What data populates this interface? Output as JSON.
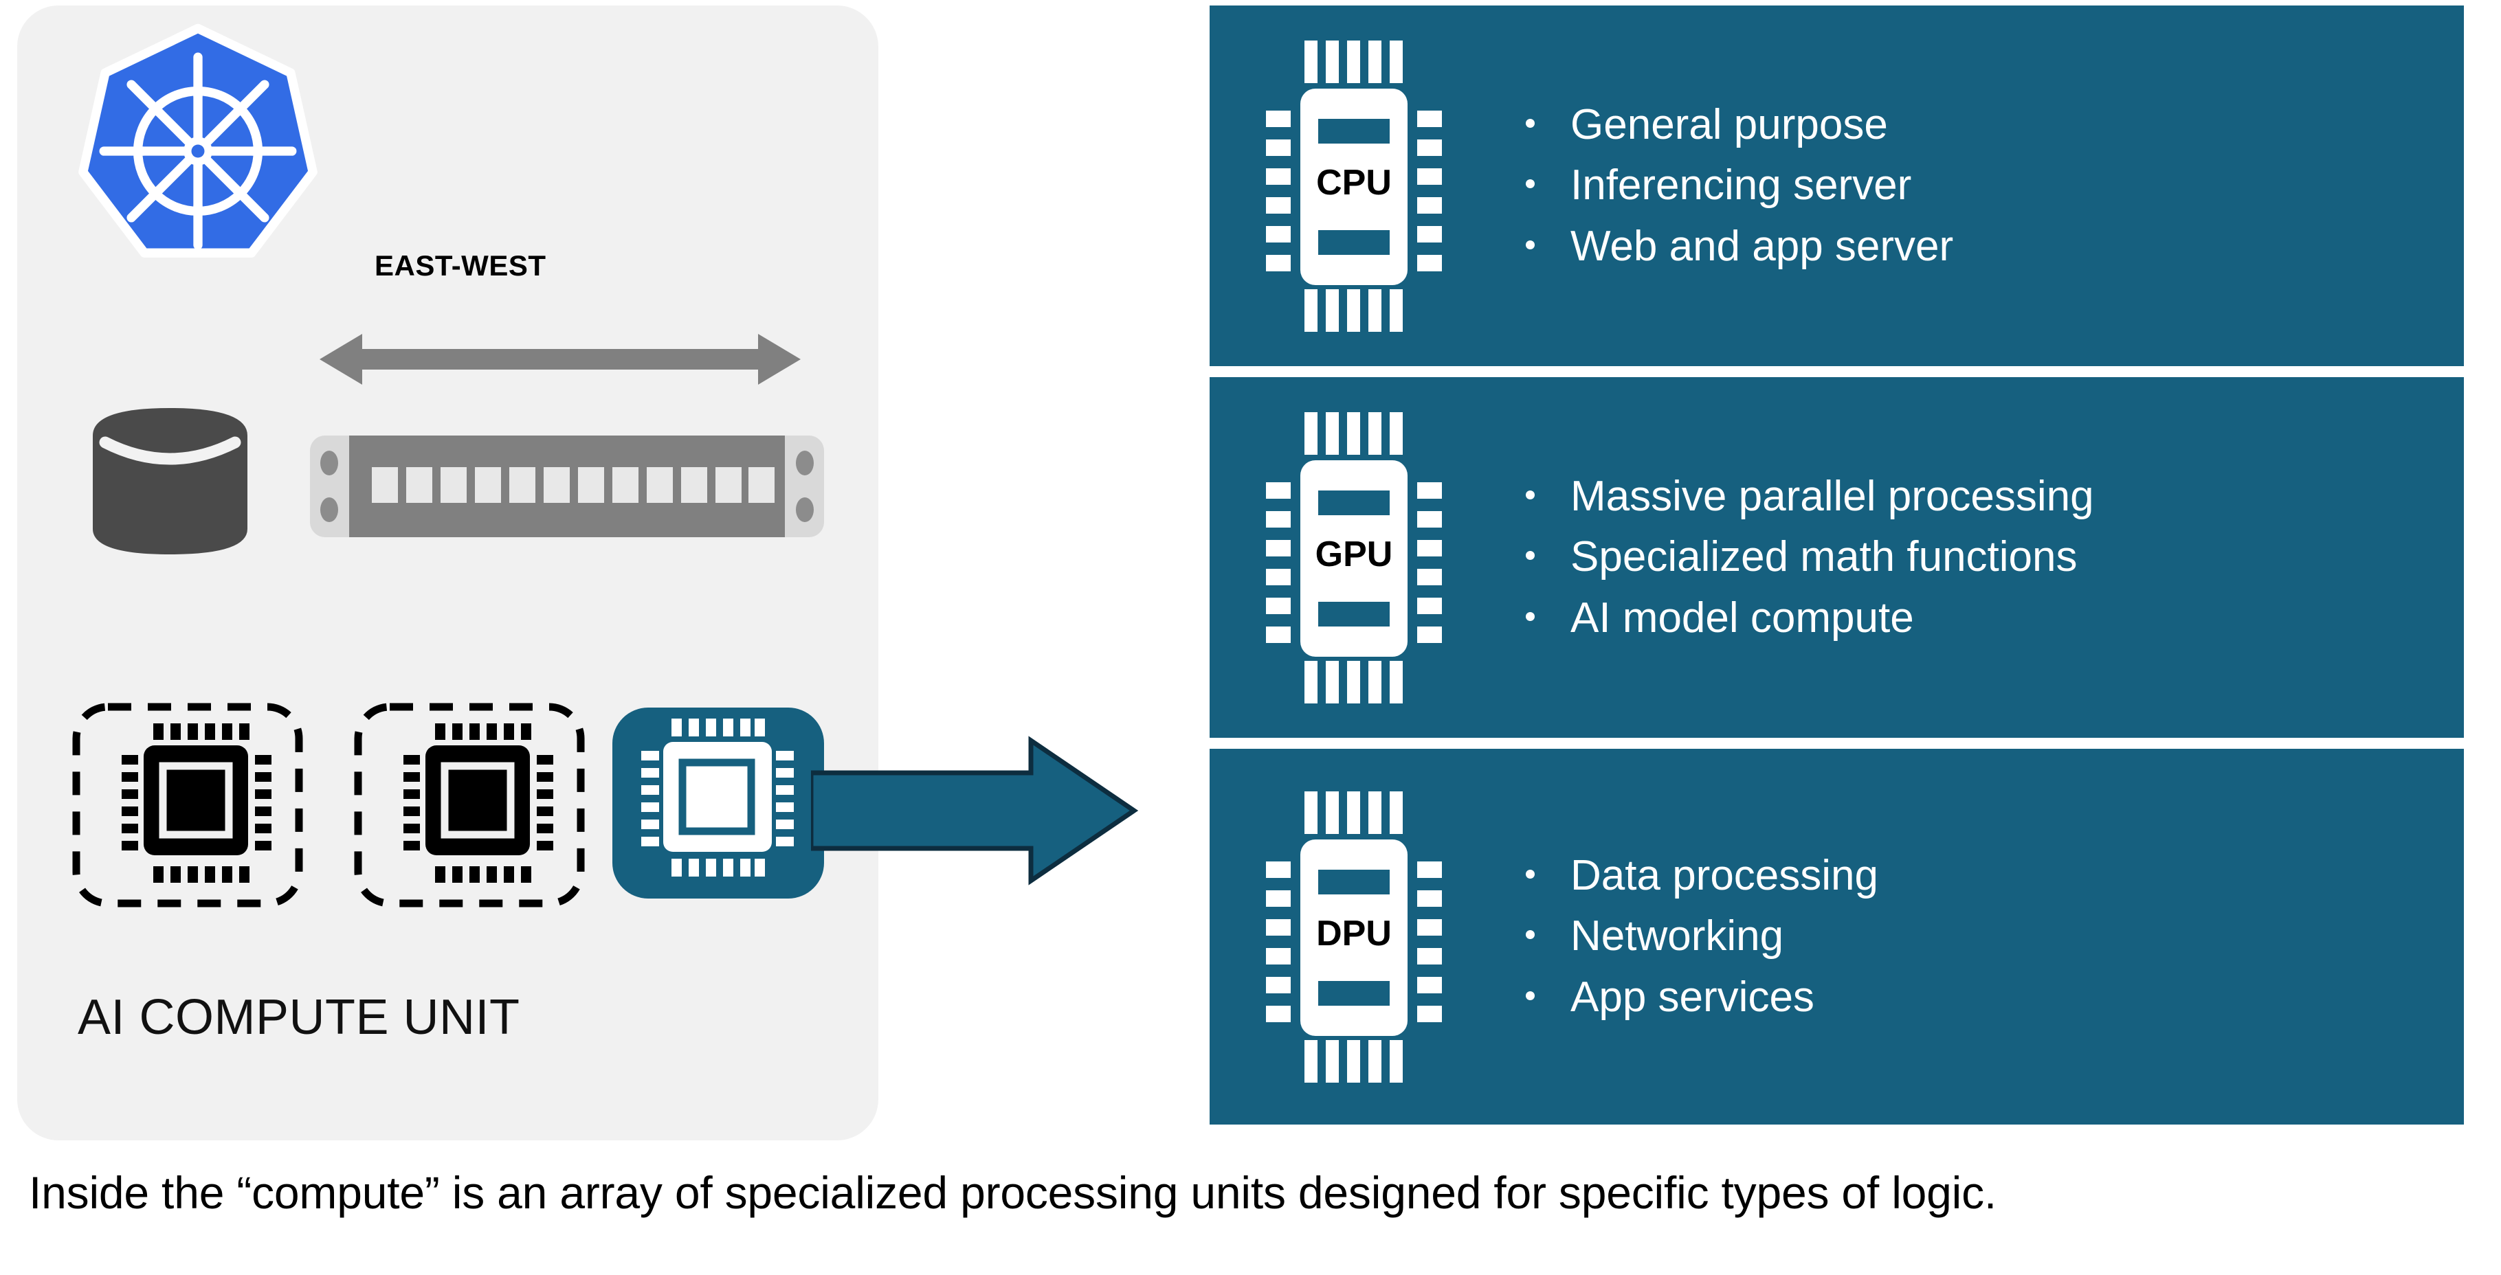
{
  "colors": {
    "panel_bg": "#f1f1f1",
    "teal": "#16607f",
    "arrow_outline": "#0d2d3f",
    "kubernetes_blue": "#326ce5",
    "switch_gray": "#808080",
    "switch_rail": "#d9d9d9",
    "db_gray": "#4a4a4a",
    "ew_arrow_gray": "#808080",
    "chip_black": "#000000",
    "white": "#ffffff"
  },
  "left_panel": {
    "logo_name": "kubernetes-icon",
    "east_west_label": "EAST-WEST",
    "east_west_arrow_name": "east-west-double-arrow-icon",
    "database_icon_name": "database-cylinder-icon",
    "switch_icon_name": "network-switch-icon",
    "switch_port_count": 12,
    "chips": [
      {
        "name": "chip-placeholder-1",
        "style": "dashed-outline",
        "active": false
      },
      {
        "name": "chip-placeholder-2",
        "style": "dashed-outline",
        "active": false
      },
      {
        "name": "chip-active",
        "style": "filled-teal",
        "active": true
      }
    ],
    "title": "AI COMPUTE UNIT"
  },
  "flow_arrow": {
    "name": "flow-arrow-right",
    "direction": "right"
  },
  "units": [
    {
      "id": "cpu",
      "chip_label": "CPU",
      "bullets": [
        "General purpose",
        "Inferencing server",
        "Web and app server"
      ]
    },
    {
      "id": "gpu",
      "chip_label": "GPU",
      "bullets": [
        "Massive parallel processing",
        "Specialized math functions",
        "AI model compute"
      ]
    },
    {
      "id": "dpu",
      "chip_label": "DPU",
      "bullets": [
        "Data processing",
        "Networking",
        "App services"
      ]
    }
  ],
  "caption": "Inside the “compute” is an array of specialized processing units designed for specific types of logic."
}
